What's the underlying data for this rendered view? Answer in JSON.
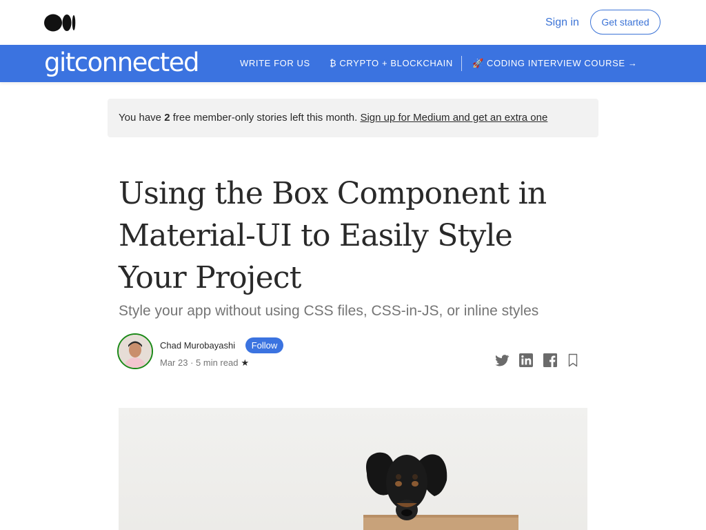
{
  "topbar": {
    "logo_icon": "medium-logo-icon",
    "signin_label": "Sign in",
    "getstarted_label": "Get started"
  },
  "publication": {
    "name": "gitconnected",
    "nav": [
      {
        "label": "WRITE FOR US"
      },
      {
        "label": "₿ CRYPTO + BLOCKCHAIN"
      },
      {
        "label": "🚀 CODING INTERVIEW COURSE →"
      }
    ]
  },
  "banner": {
    "prefix": "You have ",
    "count": "2",
    "suffix": " free member-only stories left this month. ",
    "link": "Sign up for Medium and get an extra one"
  },
  "article": {
    "title": "Using the Box Component in Material-UI to Easily Style Your Project",
    "subtitle": "Style your app without using CSS files, CSS-in-JS, or inline styles",
    "author": "Chad Murobayashi",
    "follow_label": "Follow",
    "date": "Mar 23",
    "separator": " · ",
    "read_time": "5 min read",
    "star": "★"
  },
  "share_icons": [
    "twitter-icon",
    "linkedin-icon",
    "facebook-icon",
    "bookmark-icon"
  ],
  "colors": {
    "brand": "#3b73e0",
    "link": "#3b73d6",
    "banner_bg": "#f2f2f2",
    "text": "#292929",
    "muted": "#757575"
  }
}
